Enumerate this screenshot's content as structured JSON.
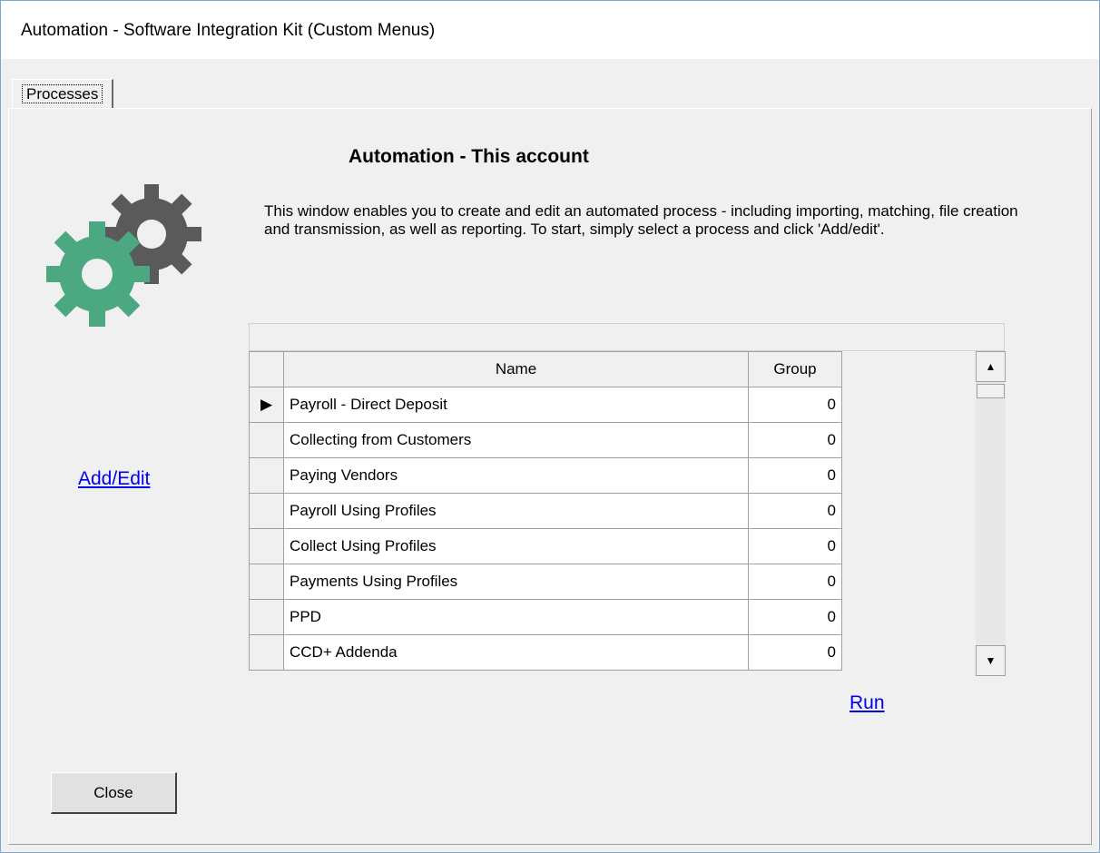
{
  "window": {
    "title": "Automation - Software Integration Kit (Custom Menus)"
  },
  "tabs": [
    {
      "label": "Processes"
    }
  ],
  "main": {
    "heading": "Automation - This account",
    "description": "This window enables you to create and edit an automated process - including importing, matching, file creation and transmission, as well as reporting.  To start, simply select a process and click 'Add/edit'.",
    "add_edit_link": "Add/Edit",
    "run_link": "Run",
    "close_button": "Close"
  },
  "grid": {
    "columns": [
      "Name",
      "Group"
    ],
    "rows": [
      {
        "name": "Payroll - Direct Deposit",
        "group": "0",
        "selected": true
      },
      {
        "name": "Collecting from Customers",
        "group": "0"
      },
      {
        "name": "Paying Vendors",
        "group": "0"
      },
      {
        "name": "Payroll Using Profiles",
        "group": "0"
      },
      {
        "name": "Collect Using Profiles",
        "group": "0"
      },
      {
        "name": "Payments Using Profiles",
        "group": "0"
      },
      {
        "name": "PPD",
        "group": "0"
      },
      {
        "name": "CCD+ Addenda",
        "group": "0"
      }
    ]
  },
  "icons": {
    "gears": "gears-icon",
    "row_pointer": "row-pointer-icon",
    "scroll_up": "scroll-up-icon",
    "scroll_down": "scroll-down-icon"
  },
  "colors": {
    "gear_green": "#4ba880",
    "gear_gray": "#5a5a5a",
    "link": "#0000ee"
  }
}
